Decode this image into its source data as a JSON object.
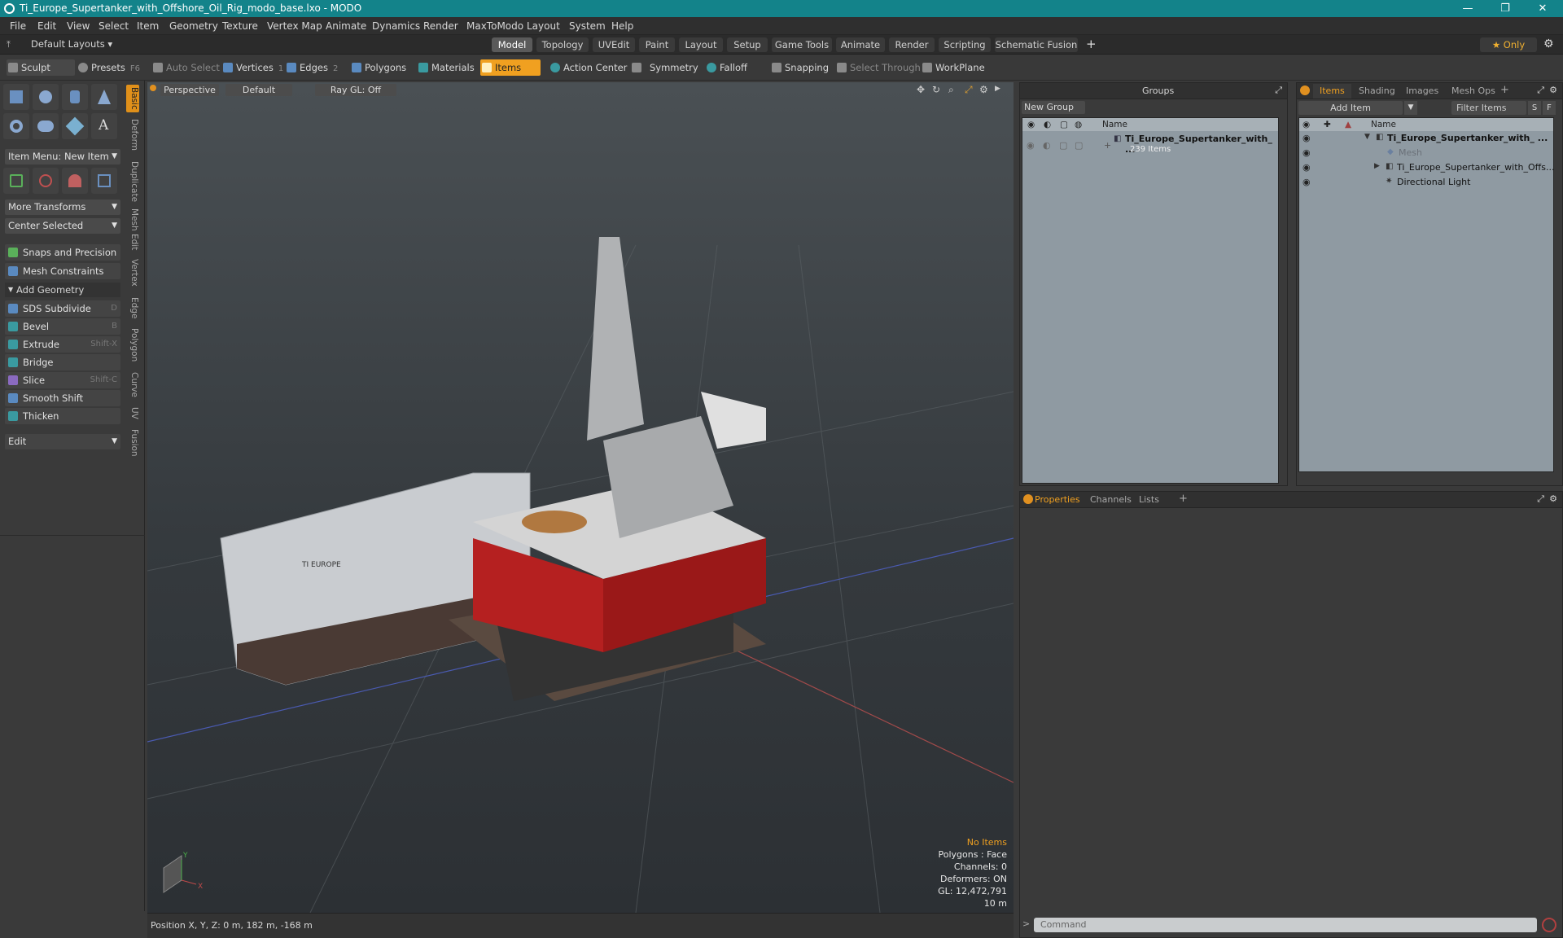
{
  "window": {
    "title": "Ti_Europe_Supertanker_with_Offshore_Oil_Rig_modo_base.lxo - MODO",
    "minimize": "—",
    "maximize": "❐",
    "close": "✕"
  },
  "menu": [
    "File",
    "Edit",
    "View",
    "Select",
    "Item",
    "Geometry",
    "Texture",
    "Vertex Map",
    "Animate",
    "Dynamics",
    "Render",
    "MaxToModo",
    "Layout",
    "System",
    "Help"
  ],
  "layoutbar": {
    "default_layouts": "Default Layouts ▾",
    "tabs": [
      "Model",
      "Topology",
      "UVEdit",
      "Paint",
      "Layout",
      "Setup",
      "Game Tools",
      "Animate",
      "Render",
      "Scripting",
      "Schematic Fusion"
    ],
    "active_tab": "Model",
    "add": "+",
    "only": "★ Only",
    "gear": "⚙"
  },
  "toolbar": {
    "sculpt": "Sculpt",
    "presets": "Presets",
    "presets_key": "F6",
    "auto_select": "Auto Select",
    "vertices": "Vertices",
    "vertices_num": "1",
    "edges": "Edges",
    "edges_num": "2",
    "polygons": "Polygons",
    "materials": "Materials",
    "items": "Items",
    "action_center": "Action Center",
    "symmetry": "Symmetry",
    "falloff": "Falloff",
    "snapping": "Snapping",
    "select_through": "Select Through",
    "workplane": "WorkPlane"
  },
  "left": {
    "item_menu": "Item Menu: New Item",
    "more_transforms": "More Transforms",
    "center_selected": "Center Selected",
    "snaps": "Snaps and Precision",
    "mesh_constraints": "Mesh Constraints",
    "add_geometry": "Add Geometry",
    "tools": [
      {
        "label": "SDS Subdivide",
        "key": "D"
      },
      {
        "label": "Bevel",
        "key": "B"
      },
      {
        "label": "Extrude",
        "key": "Shift-X"
      },
      {
        "label": "Bridge",
        "key": ""
      },
      {
        "label": "Slice",
        "key": "Shift-C"
      },
      {
        "label": "Smooth Shift",
        "key": ""
      },
      {
        "label": "Thicken",
        "key": ""
      }
    ],
    "edit": "Edit",
    "vtabs": [
      "Basic",
      "Deform",
      "Duplicate",
      "Mesh Edit",
      "Vertex",
      "Edge",
      "Polygon",
      "Curve",
      "UV",
      "Fusion"
    ]
  },
  "viewport": {
    "view": "Perspective",
    "shading": "Default",
    "raygl": "Ray GL: Off",
    "stats": {
      "selection": "No Items",
      "polygons": "Polygons : Face",
      "channels": "Channels: 0",
      "deformers": "Deformers: ON",
      "gl": "GL: 12,472,791",
      "scale": "10 m"
    },
    "axis_y": "Y",
    "axis_x": "X",
    "hull_text": "TI EUROPE"
  },
  "statusbar": {
    "position": "Position X, Y, Z:   0 m, 182 m, -168 m"
  },
  "groups": {
    "title": "Groups",
    "new_group": "New Group",
    "col_name": "Name",
    "row_name": "Ti_Europe_Supertanker_with_ ...",
    "row_sub": "239 Items"
  },
  "items": {
    "tabs": [
      "Items",
      "Shading",
      "Images",
      "Mesh Ops"
    ],
    "add_item": "Add Item",
    "filter": "Filter Items",
    "s": "S",
    "f": "F",
    "col_name": "Name",
    "rows": [
      "Ti_Europe_Supertanker_with_ ...",
      "Mesh",
      "Ti_Europe_Supertanker_with_Offs...",
      "Directional Light"
    ]
  },
  "props": {
    "tabs": [
      "Properties",
      "Channels",
      "Lists"
    ],
    "add": "+"
  },
  "command": {
    "placeholder": "Command",
    "arrow": ">"
  }
}
